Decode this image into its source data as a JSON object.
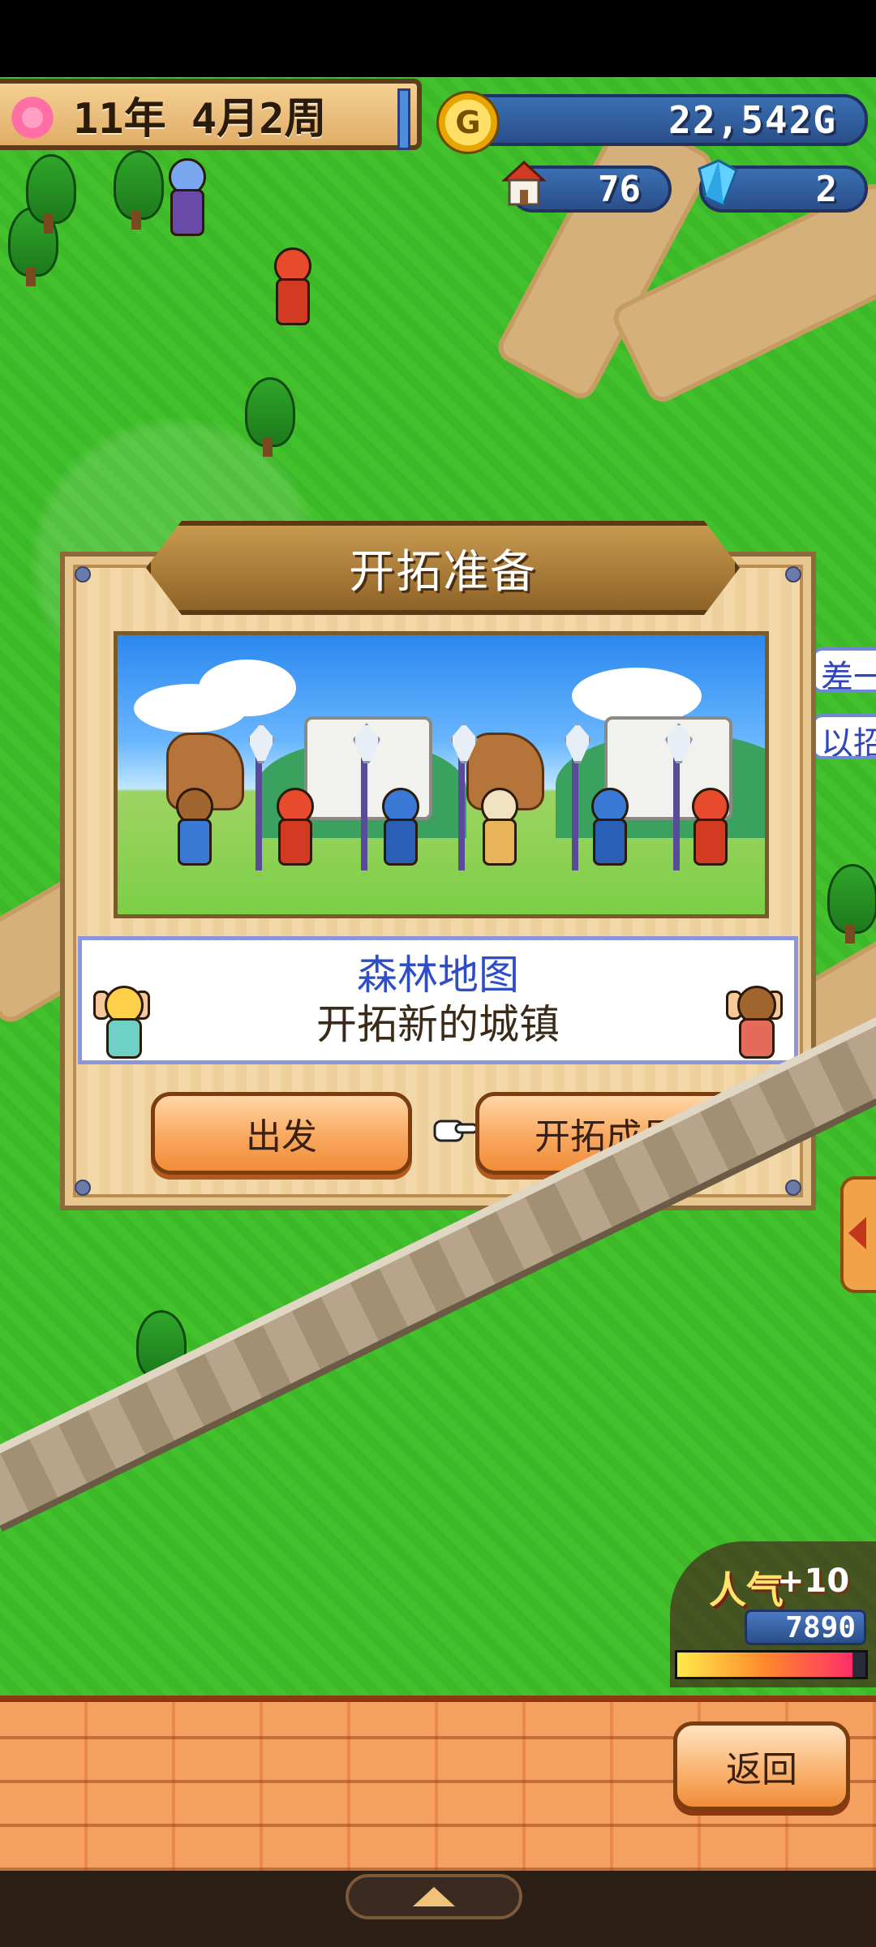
{
  "hud": {
    "date": "11年 4月2周",
    "gold": "22,542G",
    "coin_glyph": "G",
    "houses": "76",
    "gems": "2"
  },
  "side_bubbles": [
    "差一",
    "以招"
  ],
  "dialog": {
    "title": "开拓准备",
    "map_name": "森林地图",
    "description": "开拓新的城镇",
    "depart_button": "出发",
    "members_button": "开拓成员"
  },
  "popularity": {
    "label": "人气",
    "bonus": "+10",
    "value": "7890",
    "fill": 0.93
  },
  "bottom": {
    "back_button": "返回"
  },
  "colors": {
    "grass": "#43c12d",
    "panel": "#f2d8a8",
    "accent_blue": "#2f4ec6",
    "button_orange": "#f9a85f"
  }
}
